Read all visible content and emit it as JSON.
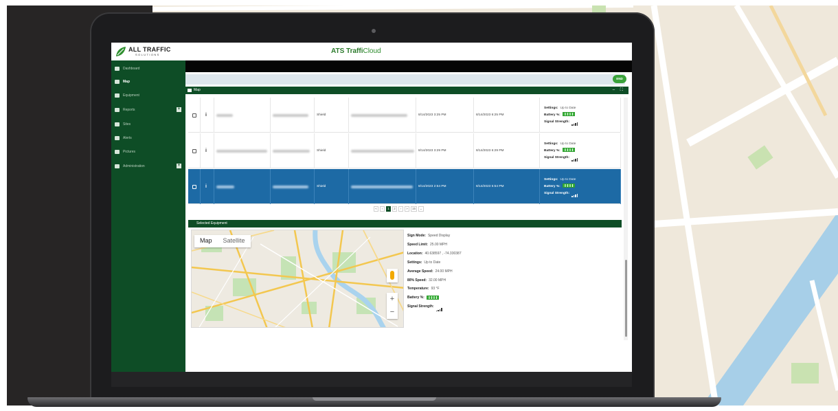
{
  "app": {
    "title_bold": "ATS Traffi",
    "title_rest": "Cloud",
    "logo_main": "ALL TRAFFIC",
    "logo_sub": "SOLUTIONS"
  },
  "sidebar": {
    "items": [
      {
        "label": "Dashboard"
      },
      {
        "label": "Map"
      },
      {
        "label": "Equipment"
      },
      {
        "label": "Reports"
      },
      {
        "label": "Sites"
      },
      {
        "label": "Alerts"
      },
      {
        "label": "Pictures"
      },
      {
        "label": "Administration"
      }
    ]
  },
  "toolbar": {
    "end_label": "END"
  },
  "map_panel": {
    "title": "Map",
    "controls": "– ⛶"
  },
  "table": {
    "rows": [
      {
        "type": "Shield",
        "start": "8/14/2023 3:25 PM",
        "end": "8/14/2023 6:25 PM",
        "settings": "Up to Date",
        "selected": false
      },
      {
        "type": "Shield",
        "start": "8/14/2023 3:29 PM",
        "end": "8/14/2023 6:29 PM",
        "settings": "Up to Date",
        "selected": false
      },
      {
        "type": "Shield",
        "start": "8/14/2023 2:54 PM",
        "end": "8/14/2023 5:54 PM",
        "settings": "Up to Date",
        "selected": true
      }
    ],
    "status_labels": {
      "settings": "Settings:",
      "battery": "Battery %:",
      "signal": "Signal Strength:"
    }
  },
  "pager": {
    "items": [
      "«",
      "‹",
      "1",
      "2",
      "›",
      "»",
      "15",
      "⌄"
    ],
    "active": "1"
  },
  "selected_panel": {
    "title": "Selected Equipment"
  },
  "mini_map": {
    "tab_map": "Map",
    "tab_satellite": "Satellite",
    "zoom_in": "+",
    "zoom_out": "−"
  },
  "equipment_info": {
    "sign_mode_label": "Sign Mode:",
    "sign_mode": "Speed Display",
    "speed_limit_label": "Speed Limit:",
    "speed_limit": "25.00 MPH",
    "location_label": "Location:",
    "location": "40.638597 , -74.330387",
    "settings_label": "Settings:",
    "settings": "Up to Date",
    "avg_speed_label": "Average Speed:",
    "avg_speed": "24.00 MPH",
    "p80_label": "80% Speed:",
    "p80": "32.00 MPH",
    "temperature_label": "Temperature:",
    "temperature": "93 °F",
    "battery_label": "Battery %:",
    "signal_label": "Signal Strength:"
  },
  "colors": {
    "brand_green": "#0e4d26",
    "selected_blue": "#1d6aa5",
    "end_button": "#3aa23a"
  }
}
